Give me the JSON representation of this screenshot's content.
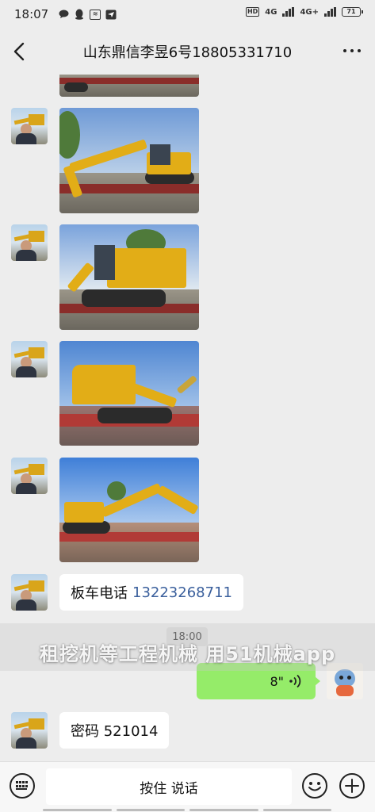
{
  "status_bar": {
    "time": "18:07",
    "hd_label": "HD",
    "net1_label": "4G",
    "net2_label": "4G+",
    "battery_label": "71"
  },
  "header": {
    "title": "山东鼎信李昱6号18805331710"
  },
  "messages": {
    "phone_msg_label": "板车电话",
    "phone_number": "13223268711",
    "time_divider": "18:00",
    "voice_duration": "8\"",
    "password_text": "密码 521014"
  },
  "watermark_text": "租挖机等工程机械 用51机械app",
  "input_bar": {
    "hold_to_talk": "按住 说话"
  },
  "colors": {
    "voice_bubble": "#95ec69",
    "link_phone": "#3a5f9c",
    "background": "#ededed"
  }
}
